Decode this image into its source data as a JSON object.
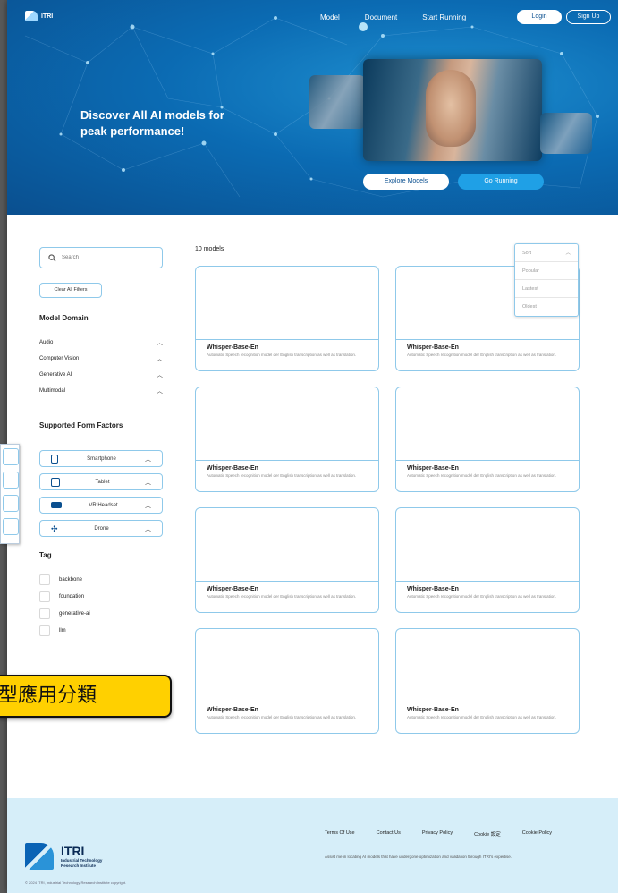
{
  "nav": {
    "logo_text": "ITRI",
    "links": [
      "Model",
      "Document",
      "Start Running"
    ],
    "login": "Login",
    "signup": "Sign Up"
  },
  "hero": {
    "title": "Discover All AI models for peak performance!",
    "explore_button": "Explore Models",
    "run_button": "Go Running"
  },
  "sidebar": {
    "search_placeholder": "Search",
    "clear_filters": "Clear All Filters",
    "model_domain_title": "Model Domain",
    "domains": [
      "Audio",
      "Computer Vision",
      "Generative AI",
      "Multimodal"
    ],
    "form_factors_title": "Supported Form Factors",
    "form_factors": [
      "Smartphone",
      "Tablet",
      "VR Headset",
      "Drone"
    ],
    "tag_title": "Tag",
    "tags": [
      "backbone",
      "foundation",
      "generative-ai",
      "llm"
    ]
  },
  "models": {
    "count": "10 models",
    "sort": {
      "label": "Sort",
      "options": [
        "Popular",
        "Lastest",
        "Oldest"
      ]
    },
    "cards": [
      {
        "title": "Whisper-Base-En",
        "description": "Automatic Speech recognition model der English transcription as well as translation."
      },
      {
        "title": "Whisper-Base-En",
        "description": "Automatic Speech recognition model der English transcription as well as translation."
      },
      {
        "title": "Whisper-Base-En",
        "description": "Automatic Speech recognition model der English transcription as well as translation."
      },
      {
        "title": "Whisper-Base-En",
        "description": "Automatic Speech recognition model der English transcription as well as translation."
      },
      {
        "title": "Whisper-Base-En",
        "description": "Automatic Speech recognition model der English transcription as well as translation."
      },
      {
        "title": "Whisper-Base-En",
        "description": "Automatic Speech recognition model der English transcription as well as translation."
      },
      {
        "title": "Whisper-Base-En",
        "description": "Automatic Speech recognition model der English transcription as well as translation."
      },
      {
        "title": "Whisper-Base-En",
        "description": "Automatic Speech recognition model der English transcription as well as translation."
      }
    ]
  },
  "callout": {
    "text": "型應用分類"
  },
  "footer": {
    "links": [
      "Terms Of Use",
      "Contact Us",
      "Privacy Policy",
      "Cookie 設定",
      "Cookie Policy"
    ],
    "description": "Assist me in locating AI models that have undergone optimization and validation through ITRI's expertise.",
    "logo_name": "ITRI",
    "logo_sub_1": "Industrial Technology",
    "logo_sub_2": "Research Institute",
    "copyright": "© 2024 ITRI, Industrial Technology Research Institute copyright."
  },
  "colors": {
    "brand_dark": "#0a4f8f",
    "accent": "#1fa0e6",
    "card_border": "#8fc9ea",
    "footer_bg": "#d6eef9",
    "callout_bg": "#ffd000"
  }
}
